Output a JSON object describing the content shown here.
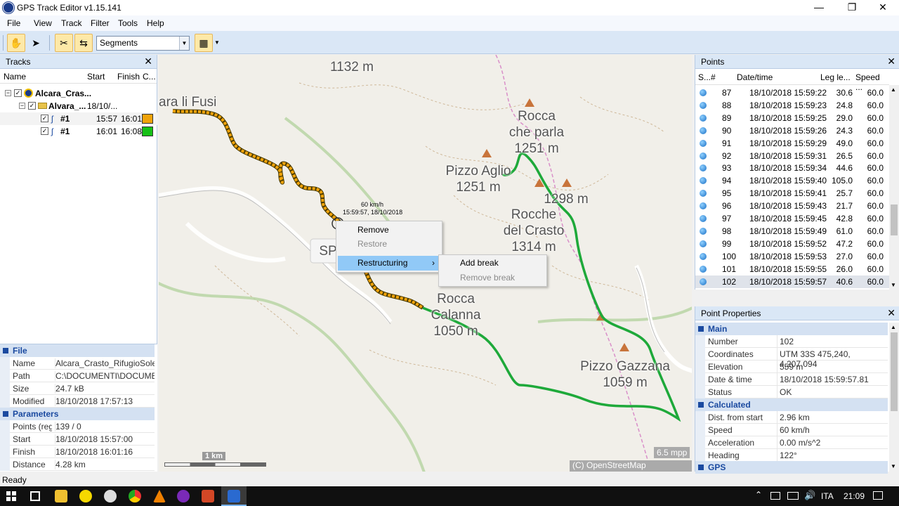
{
  "window": {
    "title": "GPS Track Editor v1.15.141",
    "minimize": "—",
    "maximize": "❐",
    "close": "✕"
  },
  "menu": [
    "File",
    "View",
    "Track",
    "Filter",
    "Tools",
    "Help"
  ],
  "toolbar": {
    "segments_value": "Segments"
  },
  "tracks": {
    "title": "Tracks",
    "columns": [
      "Name",
      "Start",
      "Finish",
      "C..."
    ],
    "root": {
      "name": "Alcara_Cras..."
    },
    "child": {
      "name": "Alvara_...",
      "date": "18/10/..."
    },
    "segments": [
      {
        "name": "#1",
        "start": "15:57",
        "finish": "16:01",
        "color": "#f0a30a"
      },
      {
        "name": "#1",
        "start": "16:01",
        "finish": "16:08",
        "color": "#16c016"
      }
    ]
  },
  "file_props": {
    "file_section": "File",
    "file_rows": [
      {
        "k": "Name",
        "v": "Alcara_Crasto_RifugioSole.gp"
      },
      {
        "k": "Path",
        "v": "C:\\DOCUMENTI\\DOCUMENT"
      },
      {
        "k": "Size",
        "v": "24.7 kB"
      },
      {
        "k": "Modified",
        "v": "18/10/2018 17:57:13"
      }
    ],
    "param_section": "Parameters",
    "param_rows": [
      {
        "k": "Points (reg",
        "v": "139 / 0"
      },
      {
        "k": "Start",
        "v": "18/10/2018 15:57:00"
      },
      {
        "k": "Finish",
        "v": "18/10/2018 16:01:16"
      },
      {
        "k": "Distance",
        "v": "4.28 km"
      }
    ]
  },
  "map": {
    "labels": [
      {
        "text": "1132 m"
      },
      {
        "text": "ara li Fusi"
      },
      {
        "text": "Rocca\nche parla\n1251 m"
      },
      {
        "text": "Pizzo Aglio\n1251 m"
      },
      {
        "text": "1298 m"
      },
      {
        "text": "Rocche\ndel Crasto\n1314 m"
      },
      {
        "text": "SP"
      },
      {
        "text": "Rocca\nCalanna\n1050 m"
      },
      {
        "text": "Pizzo Gazzana\n1059 m"
      }
    ],
    "tooltip_speed": "60 km/h",
    "tooltip_time": "15:59:57, 18/10/2018",
    "scale": "1 km",
    "mpp": "6.5 mpp",
    "attribution": "(C) OpenStreetMap contributors"
  },
  "context_menu": {
    "items": [
      {
        "label": "Remove",
        "disabled": false
      },
      {
        "label": "Restore",
        "disabled": true
      },
      {
        "label": "Restructuring",
        "disabled": false,
        "arrow": "›"
      }
    ],
    "submenu": [
      {
        "label": "Add break",
        "disabled": false
      },
      {
        "label": "Remove break",
        "disabled": true
      }
    ]
  },
  "points": {
    "title": "Points",
    "columns": [
      "S...",
      "#",
      "Date/time",
      "Leg le...",
      "Speed ..."
    ],
    "rows": [
      {
        "n": "87",
        "dt": "18/10/2018  15:59:22",
        "leg": "30.6",
        "spd": "60.0"
      },
      {
        "n": "88",
        "dt": "18/10/2018  15:59:23",
        "leg": "24.8",
        "spd": "60.0"
      },
      {
        "n": "89",
        "dt": "18/10/2018  15:59:25",
        "leg": "29.0",
        "spd": "60.0"
      },
      {
        "n": "90",
        "dt": "18/10/2018  15:59:26",
        "leg": "24.3",
        "spd": "60.0"
      },
      {
        "n": "91",
        "dt": "18/10/2018  15:59:29",
        "leg": "49.0",
        "spd": "60.0"
      },
      {
        "n": "92",
        "dt": "18/10/2018  15:59:31",
        "leg": "26.5",
        "spd": "60.0"
      },
      {
        "n": "93",
        "dt": "18/10/2018  15:59:34",
        "leg": "44.6",
        "spd": "60.0"
      },
      {
        "n": "94",
        "dt": "18/10/2018  15:59:40",
        "leg": "105.0",
        "spd": "60.0"
      },
      {
        "n": "95",
        "dt": "18/10/2018  15:59:41",
        "leg": "25.7",
        "spd": "60.0"
      },
      {
        "n": "96",
        "dt": "18/10/2018  15:59:43",
        "leg": "21.7",
        "spd": "60.0"
      },
      {
        "n": "97",
        "dt": "18/10/2018  15:59:45",
        "leg": "42.8",
        "spd": "60.0"
      },
      {
        "n": "98",
        "dt": "18/10/2018  15:59:49",
        "leg": "61.0",
        "spd": "60.0"
      },
      {
        "n": "99",
        "dt": "18/10/2018  15:59:52",
        "leg": "47.2",
        "spd": "60.0"
      },
      {
        "n": "100",
        "dt": "18/10/2018  15:59:53",
        "leg": "27.0",
        "spd": "60.0"
      },
      {
        "n": "101",
        "dt": "18/10/2018  15:59:55",
        "leg": "26.0",
        "spd": "60.0"
      },
      {
        "n": "102",
        "dt": "18/10/2018  15:59:57",
        "leg": "40.6",
        "spd": "60.0"
      }
    ]
  },
  "point_props": {
    "title": "Point Properties",
    "main_section": "Main",
    "main_rows": [
      {
        "k": "Number",
        "v": "102"
      },
      {
        "k": "Coordinates",
        "v": "UTM 33S 475,240, 4,207,094"
      },
      {
        "k": "Elevation",
        "v": "559 m"
      },
      {
        "k": "Date & time",
        "v": "18/10/2018 15:59:57.81"
      },
      {
        "k": "Status",
        "v": "OK"
      }
    ],
    "calc_section": "Calculated",
    "calc_rows": [
      {
        "k": "Dist. from start",
        "v": "2.96 km"
      },
      {
        "k": "Speed",
        "v": "60 km/h"
      },
      {
        "k": "Acceleration",
        "v": "0.00 m/s^2"
      },
      {
        "k": "Heading",
        "v": "122°"
      }
    ],
    "gps_section": "GPS"
  },
  "status": "Ready",
  "taskbar": {
    "lang": "ITA",
    "time": "21:09"
  }
}
